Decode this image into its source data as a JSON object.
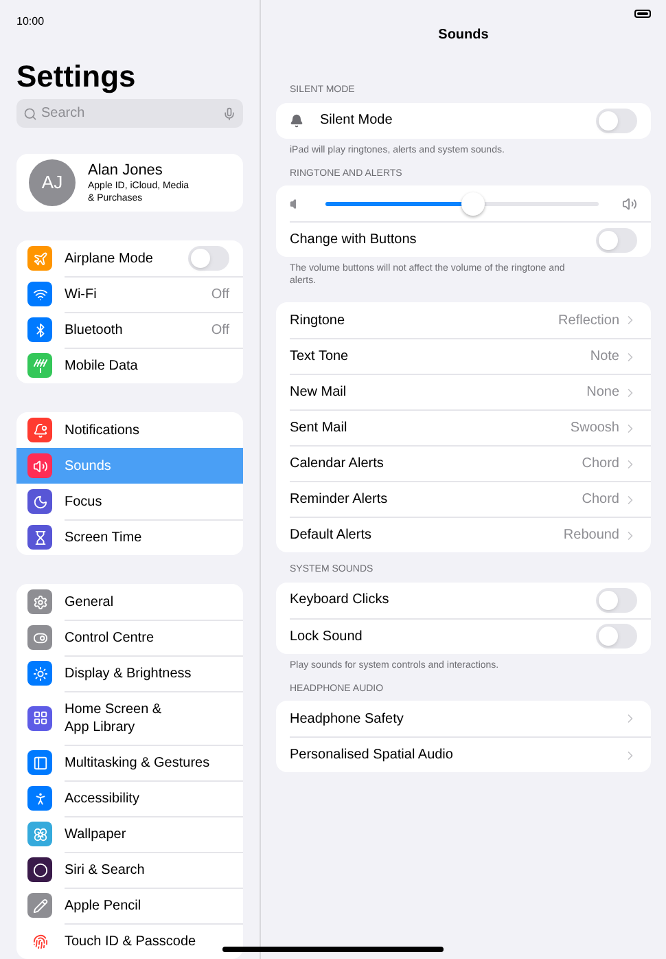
{
  "status_bar": {
    "time": "10:00"
  },
  "sidebar": {
    "title": "Settings",
    "search": {
      "placeholder": "Search"
    },
    "profile": {
      "initials": "AJ",
      "name": "Alan Jones",
      "subtitle": "Apple ID, iCloud, Media & Purchases"
    },
    "groups": [
      {
        "items": [
          {
            "label": "Airplane Mode",
            "kind": "toggle",
            "on": false,
            "selected": false
          },
          {
            "label": "Wi-Fi",
            "kind": "value",
            "value": "Off",
            "selected": false
          },
          {
            "label": "Bluetooth",
            "kind": "value",
            "value": "Off",
            "selected": false
          },
          {
            "label": "Mobile Data",
            "kind": "plain",
            "selected": false
          }
        ]
      },
      {
        "items": [
          {
            "label": "Notifications",
            "kind": "plain",
            "selected": false
          },
          {
            "label": "Sounds",
            "kind": "plain",
            "selected": true
          },
          {
            "label": "Focus",
            "kind": "plain",
            "selected": false
          },
          {
            "label": "Screen Time",
            "kind": "plain",
            "selected": false
          }
        ]
      },
      {
        "items": [
          {
            "label": "General",
            "kind": "plain",
            "selected": false
          },
          {
            "label": "Control Centre",
            "kind": "plain",
            "selected": false
          },
          {
            "label": "Display & Brightness",
            "kind": "plain",
            "selected": false
          },
          {
            "label": "Home Screen & App Library",
            "kind": "plain",
            "selected": false
          },
          {
            "label": "Multitasking & Gestures",
            "kind": "plain",
            "selected": false
          },
          {
            "label": "Accessibility",
            "kind": "plain",
            "selected": false
          },
          {
            "label": "Wallpaper",
            "kind": "plain",
            "selected": false
          },
          {
            "label": "Siri & Search",
            "kind": "plain",
            "selected": false
          },
          {
            "label": "Apple Pencil",
            "kind": "plain",
            "selected": false
          },
          {
            "label": "Touch ID & Passcode",
            "kind": "plain",
            "selected": false
          }
        ]
      }
    ]
  },
  "detail": {
    "title": "Sounds",
    "sections": [
      {
        "header": "SILENT MODE",
        "rows": [
          {
            "kind": "bell_toggle",
            "label": "Silent Mode",
            "on": false
          }
        ],
        "footer": "iPad will play ringtones, alerts and system sounds."
      },
      {
        "header": "RINGTONE AND ALERTS",
        "rows": [
          {
            "kind": "slider",
            "level": 0.54
          },
          {
            "kind": "toggle",
            "label": "Change with Buttons",
            "on": false
          }
        ],
        "footer": "The volume buttons will not affect the volume of the ringtone and alerts."
      },
      {
        "rows": [
          {
            "kind": "link",
            "label": "Ringtone",
            "value": "Reflection"
          },
          {
            "kind": "link",
            "label": "Text Tone",
            "value": "Note"
          },
          {
            "kind": "link",
            "label": "New Mail",
            "value": "None"
          },
          {
            "kind": "link",
            "label": "Sent Mail",
            "value": "Swoosh"
          },
          {
            "kind": "link",
            "label": "Calendar Alerts",
            "value": "Chord"
          },
          {
            "kind": "link",
            "label": "Reminder Alerts",
            "value": "Chord"
          },
          {
            "kind": "link",
            "label": "Default Alerts",
            "value": "Rebound"
          }
        ]
      },
      {
        "header": "SYSTEM SOUNDS",
        "rows": [
          {
            "kind": "toggle",
            "label": "Keyboard Clicks",
            "on": false
          },
          {
            "kind": "toggle",
            "label": "Lock Sound",
            "on": false
          }
        ],
        "footer": "Play sounds for system controls and interactions."
      },
      {
        "header": "HEADPHONE AUDIO",
        "rows": [
          {
            "kind": "link",
            "label": "Headphone Safety"
          },
          {
            "kind": "link",
            "label": "Personalised Spatial Audio"
          }
        ]
      }
    ]
  }
}
